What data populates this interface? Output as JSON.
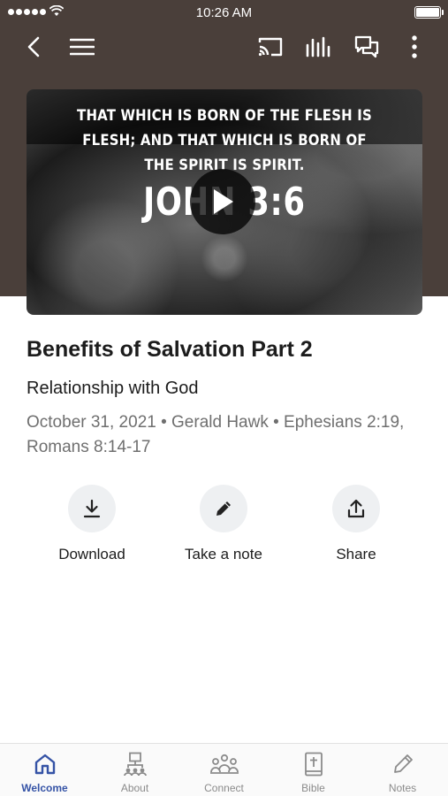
{
  "status_bar": {
    "time": "10:26 AM"
  },
  "video": {
    "verse_text": "THAT WHICH IS BORN OF THE FLESH IS FLESH; AND THAT WHICH IS BORN OF THE SPIRIT IS SPIRIT.",
    "reference": "JOHN 3:6"
  },
  "sermon": {
    "title": "Benefits of Salvation Part 2",
    "subtitle": "Relationship with God",
    "meta": "October 31, 2021 • Gerald Hawk • Ephesians 2:19, Romans 8:14-17"
  },
  "actions": [
    {
      "label": "Download",
      "icon": "download-icon"
    },
    {
      "label": "Take a note",
      "icon": "pencil-icon"
    },
    {
      "label": "Share",
      "icon": "share-icon"
    }
  ],
  "tabs": [
    {
      "label": "Welcome",
      "icon": "home-icon",
      "active": true
    },
    {
      "label": "About",
      "icon": "org-chart-icon"
    },
    {
      "label": "Connect",
      "icon": "group-icon"
    },
    {
      "label": "Bible",
      "icon": "bible-icon"
    },
    {
      "label": "Notes",
      "icon": "pencil-icon"
    }
  ],
  "colors": {
    "hero_background": "#4a3f3a",
    "accent": "#3553a6",
    "action_circle": "#eef0f2"
  }
}
